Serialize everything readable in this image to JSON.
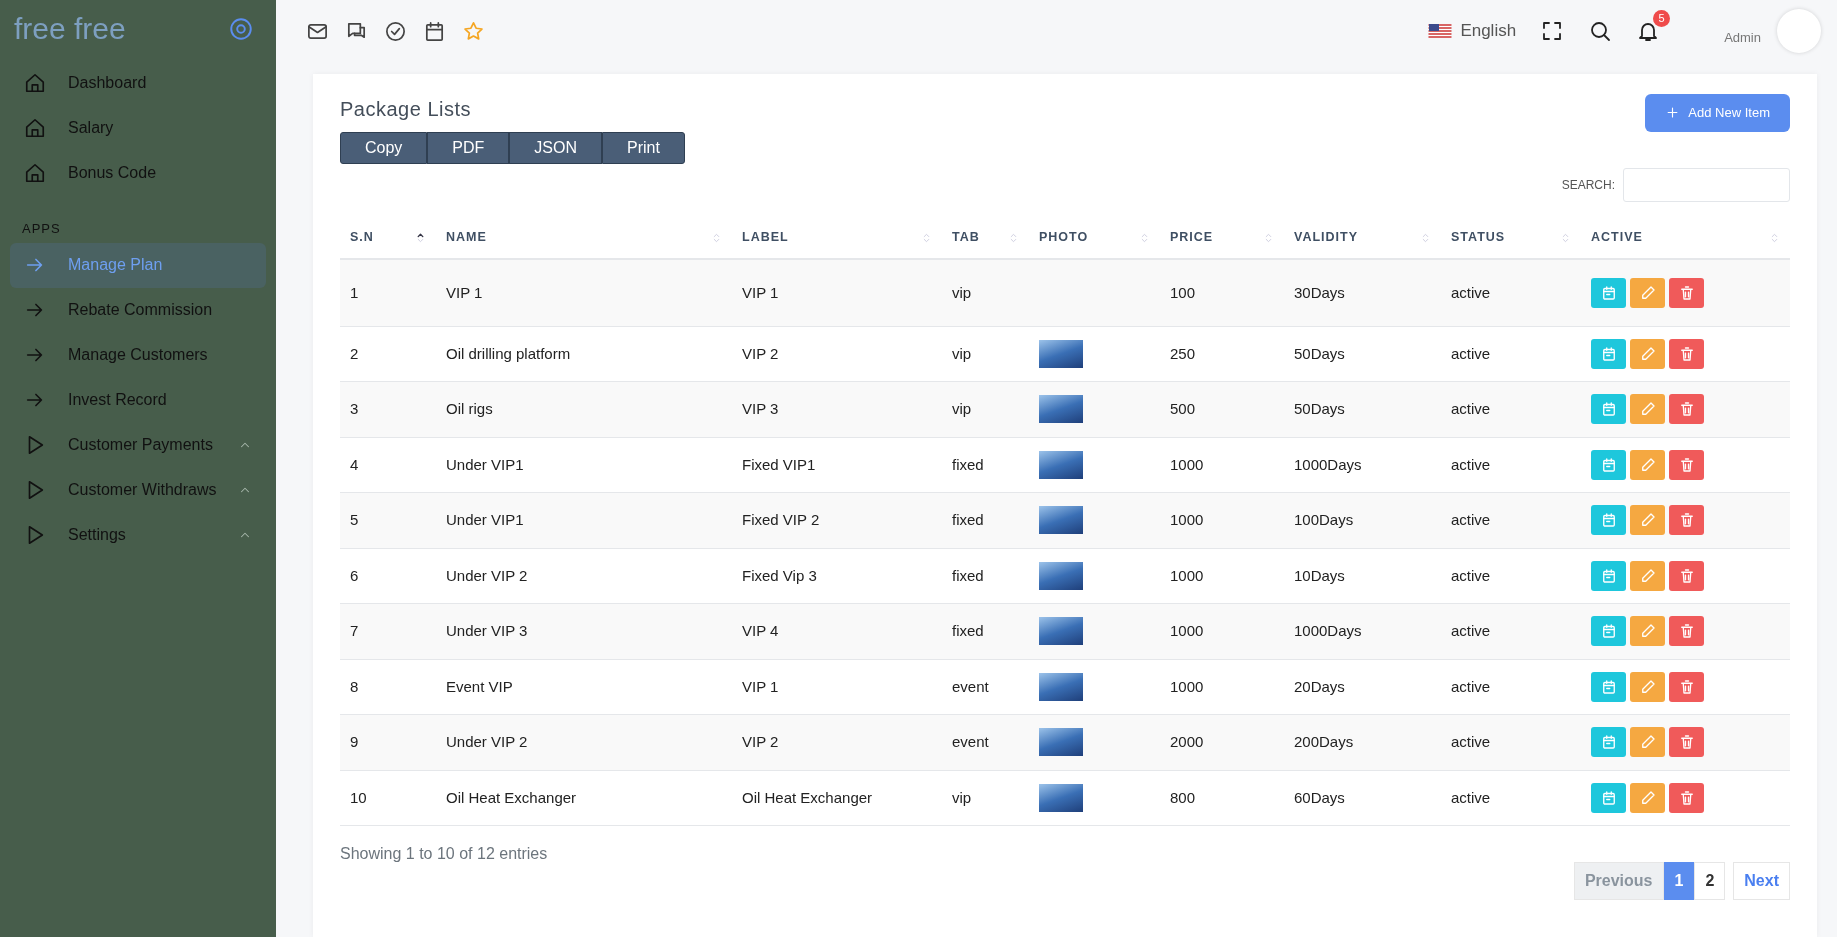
{
  "sidebar": {
    "brand": "free free",
    "items": [
      {
        "kind": "home",
        "label": "Dashboard",
        "selected": false,
        "expandable": false
      },
      {
        "kind": "home",
        "label": "Salary",
        "selected": false,
        "expandable": false
      },
      {
        "kind": "home",
        "label": "Bonus Code",
        "selected": false,
        "expandable": false
      },
      {
        "kind": "section",
        "label": "APPS"
      },
      {
        "kind": "arrow",
        "label": "Manage Plan",
        "selected": true,
        "expandable": false
      },
      {
        "kind": "arrow",
        "label": "Rebate Commission",
        "selected": false,
        "expandable": false
      },
      {
        "kind": "arrow",
        "label": "Manage Customers",
        "selected": false,
        "expandable": false
      },
      {
        "kind": "arrow",
        "label": "Invest Record",
        "selected": false,
        "expandable": false
      },
      {
        "kind": "play",
        "label": "Customer Payments",
        "selected": false,
        "expandable": true
      },
      {
        "kind": "play",
        "label": "Customer Withdraws",
        "selected": false,
        "expandable": true
      },
      {
        "kind": "play",
        "label": "Settings",
        "selected": false,
        "expandable": true
      }
    ]
  },
  "topbar": {
    "language": "English",
    "notification_count": "5",
    "user_role": "Admin"
  },
  "page": {
    "title": "Package Lists",
    "add_button": "Add New Item",
    "export_buttons": [
      "Copy",
      "PDF",
      "JSON",
      "Print"
    ],
    "search_label": "SEARCH:",
    "table": {
      "columns": [
        {
          "label": "S.N",
          "sorted": true
        },
        {
          "label": "NAME",
          "sorted": false
        },
        {
          "label": "LABEL",
          "sorted": false
        },
        {
          "label": "TAB",
          "sorted": false
        },
        {
          "label": "PHOTO",
          "sorted": false
        },
        {
          "label": "PRICE",
          "sorted": false
        },
        {
          "label": "VALIDITY",
          "sorted": false
        },
        {
          "label": "STATUS",
          "sorted": false
        },
        {
          "label": "ACTIVE",
          "sorted": false
        }
      ],
      "rows": [
        {
          "sn": "1",
          "name": "VIP 1",
          "label": "VIP 1",
          "tab": "vip",
          "has_photo": false,
          "price": "100",
          "validity": "30Days",
          "status": "active"
        },
        {
          "sn": "2",
          "name": "Oil drilling platform",
          "label": "VIP 2",
          "tab": "vip",
          "has_photo": true,
          "price": "250",
          "validity": "50Days",
          "status": "active"
        },
        {
          "sn": "3",
          "name": "Oil rigs",
          "label": "VIP 3",
          "tab": "vip",
          "has_photo": true,
          "price": "500",
          "validity": "50Days",
          "status": "active"
        },
        {
          "sn": "4",
          "name": "Under VIP1",
          "label": "Fixed VIP1",
          "tab": "fixed",
          "has_photo": true,
          "price": "1000",
          "validity": "1000Days",
          "status": "active"
        },
        {
          "sn": "5",
          "name": "Under VIP1",
          "label": "Fixed VIP 2",
          "tab": "fixed",
          "has_photo": true,
          "price": "1000",
          "validity": "100Days",
          "status": "active"
        },
        {
          "sn": "6",
          "name": "Under VIP 2",
          "label": "Fixed Vip 3",
          "tab": "fixed",
          "has_photo": true,
          "price": "1000",
          "validity": "10Days",
          "status": "active"
        },
        {
          "sn": "7",
          "name": "Under VIP 3",
          "label": "VIP 4",
          "tab": "fixed",
          "has_photo": true,
          "price": "1000",
          "validity": "1000Days",
          "status": "active"
        },
        {
          "sn": "8",
          "name": "Event VIP",
          "label": "VIP 1",
          "tab": "event",
          "has_photo": true,
          "price": "1000",
          "validity": "20Days",
          "status": "active"
        },
        {
          "sn": "9",
          "name": "Under VIP 2",
          "label": "VIP 2",
          "tab": "event",
          "has_photo": true,
          "price": "2000",
          "validity": "200Days",
          "status": "active"
        },
        {
          "sn": "10",
          "name": "Oil Heat Exchanger",
          "label": "Oil Heat Exchanger",
          "tab": "vip",
          "has_photo": true,
          "price": "800",
          "validity": "60Days",
          "status": "active"
        }
      ]
    },
    "info": "Showing 1 to 10 of 12 entries",
    "pagination": [
      {
        "kind": "prev",
        "label": "Previous",
        "disabled": true
      },
      {
        "kind": "page",
        "label": "1",
        "selected": true
      },
      {
        "kind": "page",
        "label": "2",
        "selected": false
      },
      {
        "kind": "next",
        "label": "Next",
        "disabled": false
      }
    ]
  }
}
